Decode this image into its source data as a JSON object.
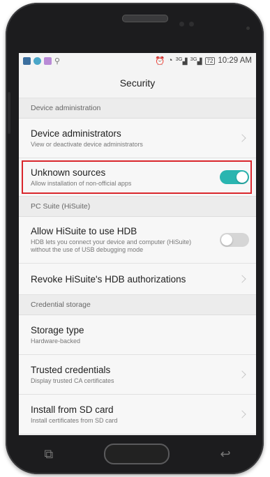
{
  "status_bar": {
    "time": "10:29 AM",
    "battery": "72",
    "signal1": "3G",
    "signal2": "3G",
    "left_icons": [
      "gallery-icon",
      "wifi-notify-icon",
      "app-notify-icon",
      "usb-icon"
    ],
    "right_icons": [
      "alarm-icon",
      "wifi-icon",
      "signal-icon",
      "signal-icon",
      "battery-icon"
    ]
  },
  "header": {
    "title": "Security"
  },
  "sections": {
    "device_admin": {
      "label": "Device administration"
    },
    "pc_suite": {
      "label": "PC Suite (HiSuite)"
    },
    "credential_storage": {
      "label": "Credential storage"
    }
  },
  "rows": {
    "device_administrators": {
      "title": "Device administrators",
      "subtitle": "View or deactivate device administrators"
    },
    "unknown_sources": {
      "title": "Unknown sources",
      "subtitle": "Allow installation of non-official apps",
      "enabled": true
    },
    "allow_hisuite": {
      "title": "Allow HiSuite to use HDB",
      "subtitle": "HDB lets you connect your device and computer (HiSuite) without the use of USB debugging mode",
      "enabled": false
    },
    "revoke_hisuite": {
      "title": "Revoke HiSuite's HDB authorizations"
    },
    "storage_type": {
      "title": "Storage type",
      "subtitle": "Hardware-backed"
    },
    "trusted_credentials": {
      "title": "Trusted credentials",
      "subtitle": "Display trusted CA certificates"
    },
    "install_sd": {
      "title": "Install from SD card",
      "subtitle": "Install certificates from SD card"
    }
  },
  "colors": {
    "toggle_on": "#2ab5b0",
    "toggle_off": "#d6d6d6",
    "highlight": "#d9262c",
    "phone_body": "#1c1c1e"
  },
  "navbar": {
    "icons": [
      "recent-apps-icon",
      "home-button",
      "back-icon"
    ]
  }
}
